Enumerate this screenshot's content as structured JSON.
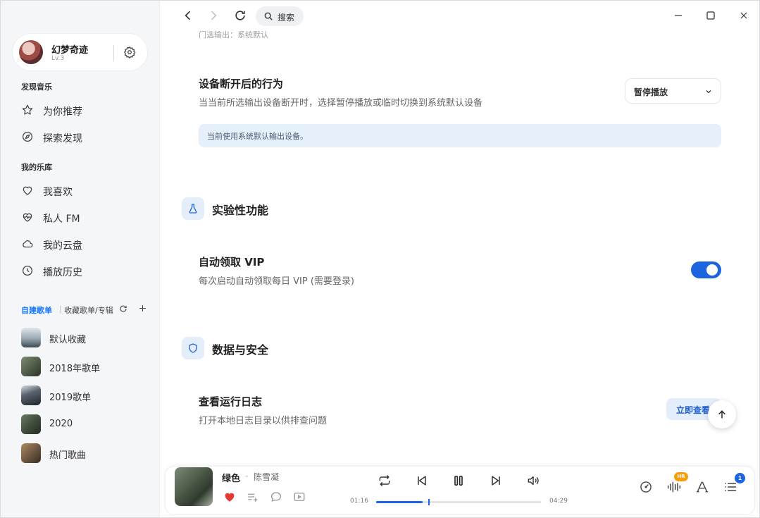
{
  "user": {
    "name": "幻梦奇迹",
    "level": "Lv.3"
  },
  "sidebar": {
    "discover_title": "发现音乐",
    "discover_items": [
      {
        "label": "为你推荐",
        "icon": "star-icon"
      },
      {
        "label": "探索发现",
        "icon": "compass-icon"
      }
    ],
    "library_title": "我的乐库",
    "library_items": [
      {
        "label": "我喜欢",
        "icon": "heart-icon"
      },
      {
        "label": "私人 FM",
        "icon": "heart-pulse-icon"
      },
      {
        "label": "我的云盘",
        "icon": "cloud-icon"
      },
      {
        "label": "播放历史",
        "icon": "clock-icon"
      }
    ],
    "playlist_tabs": {
      "active": "自建歌单",
      "separator": "|",
      "other": "收藏歌单/专辑"
    },
    "playlists": [
      {
        "name": "默认收藏",
        "cover_color": "#8a9aa6"
      },
      {
        "name": "2018年歌单",
        "cover_color": "#4e5b48"
      },
      {
        "name": "2019歌单",
        "cover_color": "#2f3640"
      },
      {
        "name": "2020",
        "cover_color": "#3d4a3a"
      },
      {
        "name": "热门歌曲",
        "cover_color": "#6b5540"
      }
    ]
  },
  "titlebar": {
    "search_label": "搜索"
  },
  "content": {
    "cut_text": "门选输出：系统默认",
    "disconnect_setting": {
      "title": "设备断开后的行为",
      "description": "当当前所选输出设备断开时，选择暂停播放或临时切换到系统默认设备",
      "selected_value": "暂停播放",
      "info": "当前使用系统默认输出设备。"
    },
    "experimental": {
      "group_title": "实验性功能",
      "vip_title": "自动领取 VIP",
      "vip_description": "每次启动自动领取每日 VIP (需要登录)",
      "vip_enabled": true
    },
    "data_security": {
      "group_title": "数据与安全",
      "log_title": "查看运行日志",
      "log_description": "打开本地日志目录以供排查问题",
      "log_button": "立即查看"
    }
  },
  "player": {
    "song_title": "绿色",
    "separator": "-",
    "artist": "陈雪凝",
    "liked": true,
    "current_time": "01:16",
    "total_time": "04:29",
    "progress_fraction": 0.283,
    "quality_badge": "HR",
    "queue_count": "1",
    "accent_color": "#1c64e0"
  }
}
